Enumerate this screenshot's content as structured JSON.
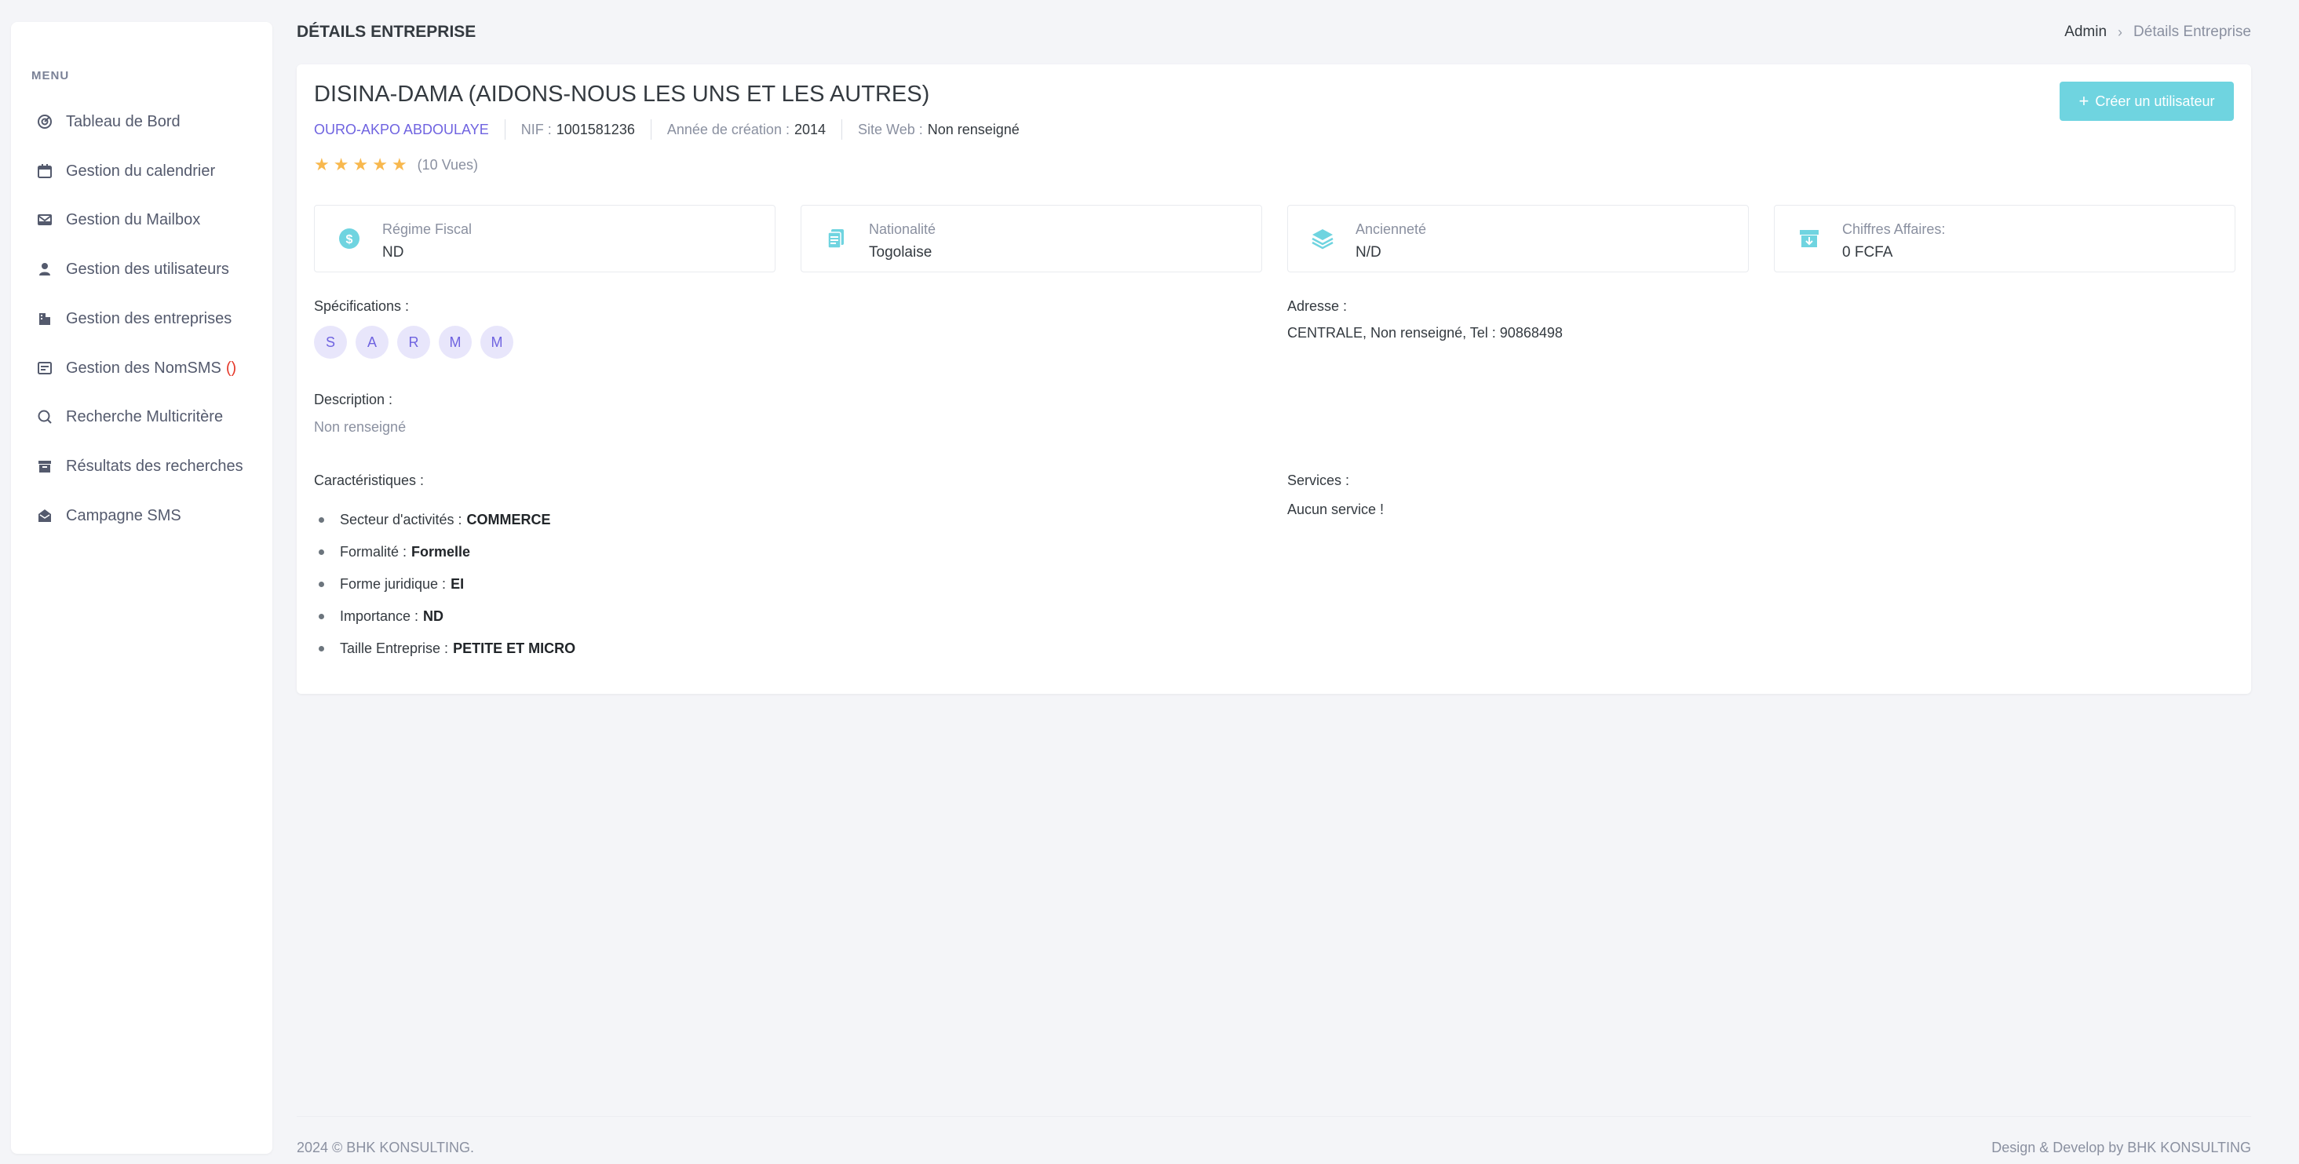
{
  "sidebar": {
    "menu_title": "MENU",
    "items": [
      {
        "label": "Tableau de Bord",
        "icon": "dashboard-icon"
      },
      {
        "label": "Gestion du calendrier",
        "icon": "calendar-icon"
      },
      {
        "label": "Gestion du Mailbox",
        "icon": "mailbox-icon"
      },
      {
        "label": "Gestion des utilisateurs",
        "icon": "user-icon"
      },
      {
        "label": "Gestion des entreprises",
        "icon": "building-icon"
      },
      {
        "label": "Gestion des NomSMS",
        "icon": "sms-icon",
        "count": "()"
      },
      {
        "label": "Recherche Multicritère",
        "icon": "search-icon"
      },
      {
        "label": "Résultats des recherches",
        "icon": "archive-icon"
      },
      {
        "label": "Campagne SMS",
        "icon": "envelope-open-icon"
      }
    ]
  },
  "header": {
    "title": "DÉTAILS ENTREPRISE",
    "breadcrumb": {
      "root": "Admin",
      "separator": "›",
      "current": "Détails Entreprise"
    }
  },
  "company": {
    "name": "DISINA-DAMA (AIDONS-NOUS LES UNS ET LES AUTRES)",
    "owner": "OURO-AKPO ABDOULAYE",
    "nif_label": "NIF :",
    "nif": "1001581236",
    "year_label": "Année de création :",
    "year": "2014",
    "website_label": "Site Web :",
    "website": "Non renseigné",
    "rating": 5,
    "star_glyph": "★",
    "views": "(10 Vues)",
    "create_user_label": "Créer un utilisateur",
    "create_user_icon": "+"
  },
  "stats": [
    {
      "label": "Régime Fiscal",
      "value": "ND",
      "icon": "dollar-circle-icon"
    },
    {
      "label": "Nationalité",
      "value": "Togolaise",
      "icon": "documents-icon"
    },
    {
      "label": "Ancienneté",
      "value": "N/D",
      "icon": "layers-icon"
    },
    {
      "label": "Chiffres Affaires:",
      "value": "0 FCFA",
      "icon": "archive-download-icon"
    }
  ],
  "specifications": {
    "label": "Spécifications :",
    "badges": [
      "S",
      "A",
      "R",
      "M",
      "M"
    ]
  },
  "address": {
    "label": "Adresse :",
    "value": "CENTRALE, Non renseigné, Tel : 90868498"
  },
  "description": {
    "label": "Description :",
    "value": "Non renseigné"
  },
  "characteristics": {
    "label": "Caractéristiques :",
    "items": [
      {
        "label": "Secteur d'activités :",
        "value": "COMMERCE"
      },
      {
        "label": "Formalité :",
        "value": "Formelle"
      },
      {
        "label": "Forme juridique :",
        "value": "EI"
      },
      {
        "label": "Importance :",
        "value": "ND"
      },
      {
        "label": "Taille Entreprise :",
        "value": "PETITE ET MICRO"
      }
    ]
  },
  "services": {
    "label": "Services :",
    "value": "Aucun service !"
  },
  "footer": {
    "left": "2024 © BHK KONSULTING.",
    "right": "Design & Develop by BHK KONSULTING"
  },
  "colors": {
    "accent": "#6f63e0",
    "button": "#6fd4e0",
    "star": "#f8b84e",
    "stat_icon": "#6fd4e0",
    "sidebar_icon": "#545a6d"
  }
}
